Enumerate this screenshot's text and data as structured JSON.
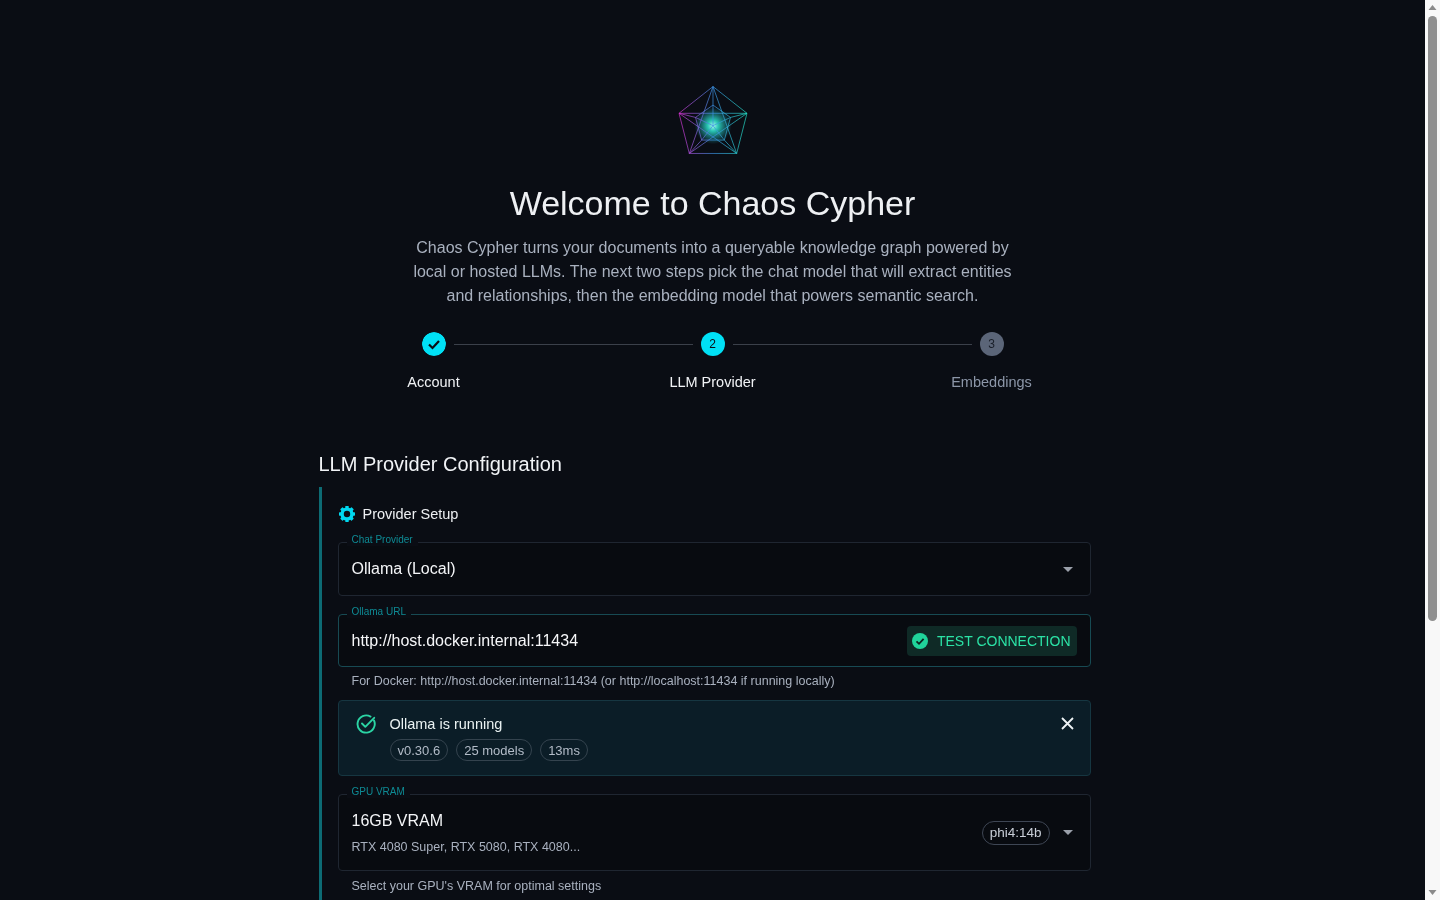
{
  "header": {
    "title": "Welcome to Chaos Cypher",
    "description": "Chaos Cypher turns your documents into a queryable knowledge graph powered by local or hosted LLMs. The next two steps pick the chat model that will extract entities and relationships, then the embedding model that powers semantic search."
  },
  "stepper": {
    "steps": [
      {
        "label": "Account",
        "completed": true,
        "selected": false
      },
      {
        "number": "2",
        "label": "LLM Provider",
        "completed": false,
        "selected": true
      },
      {
        "number": "3",
        "label": "Embeddings",
        "completed": false,
        "selected": false
      }
    ]
  },
  "section": {
    "title": "LLM Provider Configuration",
    "panel": {
      "title": "Provider Setup",
      "fields": [
        {
          "kind": "select",
          "label": "Chat Provider",
          "value": "Ollama (Local)",
          "focused": false
        },
        {
          "kind": "input",
          "label": "Ollama URL",
          "value": "http://host.docker.internal:11434",
          "focused": true,
          "action": "TEST CONNECTION",
          "helper": "For Docker: http://host.docker.internal:11434 (or http://localhost:11434 if running locally)"
        },
        {
          "kind": "alert",
          "title": "Ollama is running",
          "tags": [
            "v0.30.6",
            "25 models",
            "13ms"
          ]
        },
        {
          "kind": "select",
          "label": "GPU VRAM",
          "value": "16GB VRAM",
          "detail": "RTX 4080 Super, RTX 5080, RTX 4080...",
          "tag": "phi4:14b",
          "focused": false,
          "helper": "Select your GPU's VRAM for optimal settings"
        }
      ]
    }
  }
}
